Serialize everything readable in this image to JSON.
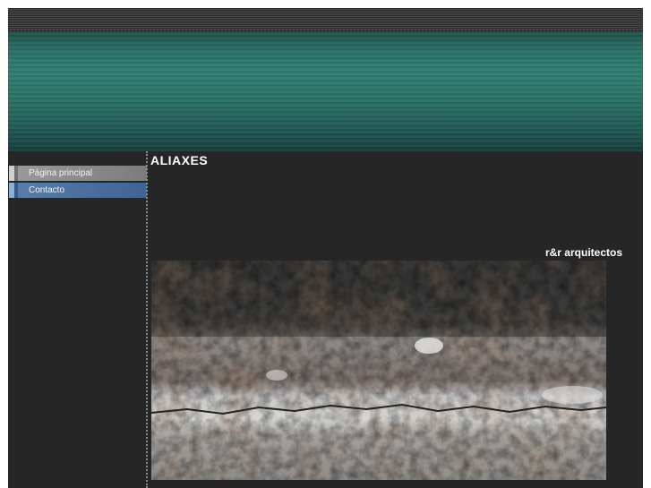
{
  "header": {
    "banner_image": "teal-horizontal-stripes-texture"
  },
  "sidebar": {
    "items": [
      {
        "label": "Página principal",
        "state": "normal"
      },
      {
        "label": "Contacto",
        "state": "active"
      }
    ]
  },
  "main": {
    "title": "ALIAXES",
    "subtitle": "r&r arquitectos",
    "photo": "weathered-concrete-wall-texture"
  },
  "colors": {
    "background": "#262626",
    "banner_teal": "#2e7d72",
    "nav_home": "#8c8c8c",
    "nav_active": "#4a6f9e",
    "text": "#ffffff"
  }
}
